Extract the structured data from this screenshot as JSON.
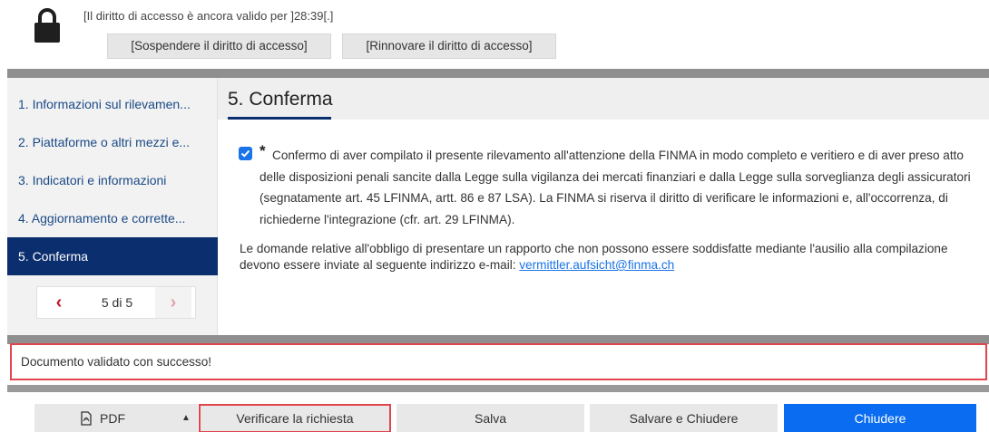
{
  "access": {
    "validity_text": "[Il diritto di accesso è ancora valido per ]28:39[.]",
    "suspend_label": "[Sospendere il diritto di accesso]",
    "renew_label": "[Rinnovare il diritto di accesso]"
  },
  "sidebar": {
    "items": [
      {
        "label": "1. Informazioni sul rilevamen..."
      },
      {
        "label": "2. Piattaforme o altri mezzi e..."
      },
      {
        "label": "3. Indicatori e informazioni"
      },
      {
        "label": "4. Aggiornamento e corrette..."
      },
      {
        "label": "5. Conferma"
      }
    ],
    "pager": {
      "label": "5 di 5",
      "prev": "‹",
      "next": "›"
    }
  },
  "content": {
    "title": "5. Conferma",
    "required_marker": "*",
    "confirm_text": "Confermo di aver compilato il presente rilevamento all'attenzione della FINMA in modo completo e veritiero e di aver preso atto delle disposizioni penali sancite dalla Legge sulla vigilanza dei mercati finanziari e dalla Legge sulla sorveglianza degli assicuratori (segnatamente art. 45 LFINMA, artt. 86 e 87 LSA). La FINMA si riserva il diritto di verificare le informazioni e, all'occorrenza, di richiederne l'integrazione (cfr. art. 29 LFINMA).",
    "email_text": "Le domande relative all'obbligo di presentare un rapporto che non possono essere soddisfatte mediante l'ausilio alla compilazione devono essere inviate al seguente indirizzo e-mail: ",
    "email": "vermittler.aufsicht@finma.ch"
  },
  "message": "Documento validato con successo!",
  "footer": {
    "pdf_label": "PDF",
    "pdf_caret": "▲",
    "verify_label": "Verificare la richiesta",
    "save_label": "Salva",
    "save_close_label": "Salvare e Chiudere",
    "close_label": "Chiudere"
  },
  "colors": {
    "accent": "#0b2e6f",
    "primary_button": "#0a6cf0",
    "highlight": "#e0454c",
    "link": "#1a73e8"
  },
  "icons": [
    "lock-icon",
    "check-icon",
    "chevron-left-icon",
    "chevron-right-icon",
    "pdf-icon",
    "caret-up-icon"
  ]
}
